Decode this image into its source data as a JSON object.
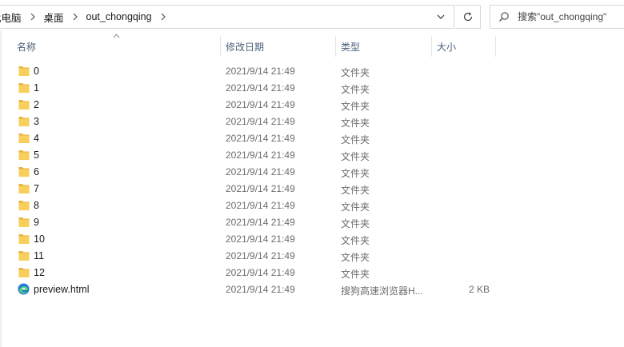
{
  "breadcrumb": {
    "items": [
      "此电脑",
      "桌面",
      "out_chongqing"
    ]
  },
  "search": {
    "placeholder": "搜索\"out_chongqing\""
  },
  "columns": {
    "name": "名称",
    "date": "修改日期",
    "type": "类型",
    "size": "大小"
  },
  "files": [
    {
      "name": "0",
      "date": "2021/9/14 21:49",
      "type": "文件夹",
      "size": "",
      "icon": "folder-icon"
    },
    {
      "name": "1",
      "date": "2021/9/14 21:49",
      "type": "文件夹",
      "size": "",
      "icon": "folder-icon"
    },
    {
      "name": "2",
      "date": "2021/9/14 21:49",
      "type": "文件夹",
      "size": "",
      "icon": "folder-icon"
    },
    {
      "name": "3",
      "date": "2021/9/14 21:49",
      "type": "文件夹",
      "size": "",
      "icon": "folder-icon"
    },
    {
      "name": "4",
      "date": "2021/9/14 21:49",
      "type": "文件夹",
      "size": "",
      "icon": "folder-icon"
    },
    {
      "name": "5",
      "date": "2021/9/14 21:49",
      "type": "文件夹",
      "size": "",
      "icon": "folder-icon"
    },
    {
      "name": "6",
      "date": "2021/9/14 21:49",
      "type": "文件夹",
      "size": "",
      "icon": "folder-icon"
    },
    {
      "name": "7",
      "date": "2021/9/14 21:49",
      "type": "文件夹",
      "size": "",
      "icon": "folder-icon"
    },
    {
      "name": "8",
      "date": "2021/9/14 21:49",
      "type": "文件夹",
      "size": "",
      "icon": "folder-icon"
    },
    {
      "name": "9",
      "date": "2021/9/14 21:49",
      "type": "文件夹",
      "size": "",
      "icon": "folder-icon"
    },
    {
      "name": "10",
      "date": "2021/9/14 21:49",
      "type": "文件夹",
      "size": "",
      "icon": "folder-icon"
    },
    {
      "name": "11",
      "date": "2021/9/14 21:49",
      "type": "文件夹",
      "size": "",
      "icon": "folder-icon"
    },
    {
      "name": "12",
      "date": "2021/9/14 21:49",
      "type": "文件夹",
      "size": "",
      "icon": "folder-icon"
    },
    {
      "name": "preview.html",
      "date": "2021/9/14 21:49",
      "type": "搜狗高速浏览器H...",
      "size": "2 KB",
      "icon": "edge-html-icon"
    }
  ],
  "colors": {
    "folder": "#f8cf5a",
    "folder_dark": "#e6b23a",
    "header_text": "#4c607a"
  }
}
